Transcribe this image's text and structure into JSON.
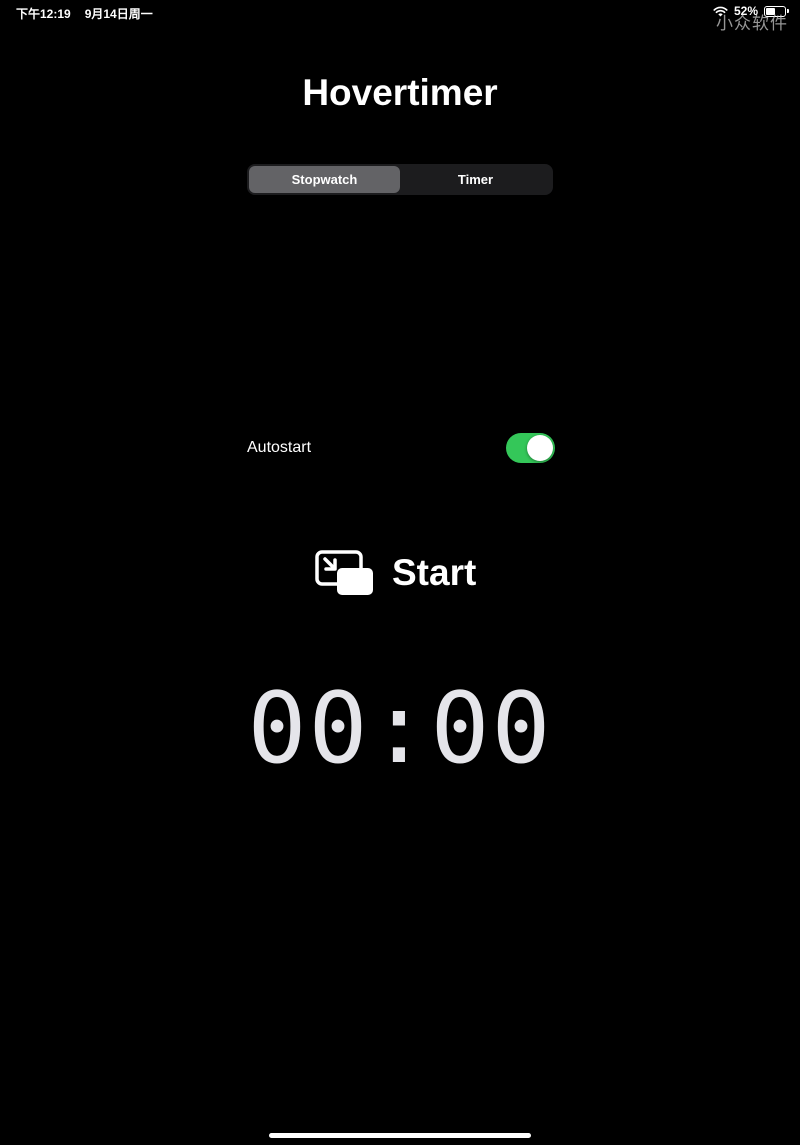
{
  "status_bar": {
    "time": "下午12:19",
    "date": "9月14日周一",
    "battery": "52%",
    "battery_level": 0.52,
    "watermark": "小众软件"
  },
  "app": {
    "title": "Hovertimer"
  },
  "mode_selector": {
    "options": [
      "Stopwatch",
      "Timer"
    ],
    "selected": "Stopwatch"
  },
  "settings": {
    "autostart_label": "Autostart",
    "autostart_enabled": true
  },
  "start_button": {
    "label": "Start",
    "icon": "pip-icon"
  },
  "timer": {
    "display": "00:00"
  },
  "colors": {
    "background": "#000000",
    "toggle_on": "#34c759",
    "segment_selected": "#636366",
    "segment_bg": "#1c1c1e",
    "text": "#ffffff"
  }
}
